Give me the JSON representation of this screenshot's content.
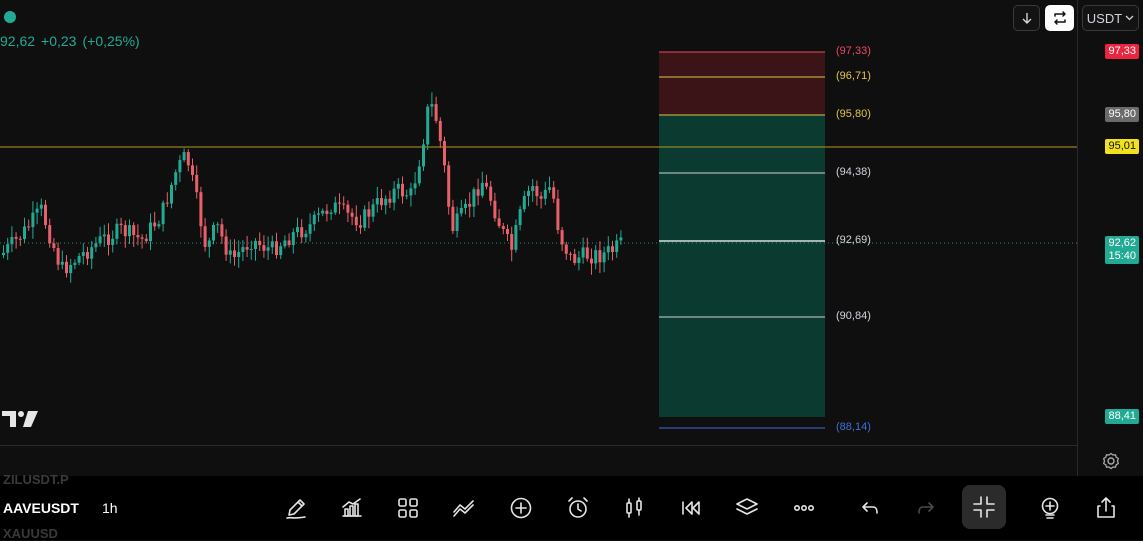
{
  "symbol_quote": {
    "price": "92,62",
    "change": "+0,23",
    "change_pct": "(+0,25%)"
  },
  "currency_selector": "USDT",
  "price_scale": {
    "stop_price": "97,33",
    "grey_price": "95,80",
    "horizontal_line_price": "95,01",
    "current_price": "92,62",
    "countdown": "15:40",
    "target_price": "88,41"
  },
  "position_levels": [
    {
      "label": "(97,33)",
      "color": "#e84a5f"
    },
    {
      "label": "(96,71)",
      "color": "#e0c34a"
    },
    {
      "label": "(95,80)",
      "color": "#e0c34a"
    },
    {
      "label": "(94,38)",
      "color": "#d1d4dc"
    },
    {
      "label": "(92,69)",
      "color": "#d1d4dc"
    },
    {
      "label": "(90,84)",
      "color": "#d1d4dc"
    },
    {
      "label": "(88,14)",
      "color": "#3f6fd8"
    }
  ],
  "watchlist": {
    "prev_symbol": "ZILUSDT.P",
    "current_symbol": "AAVEUSDT",
    "next_symbol": "XAUUSD",
    "timeframe": "1h"
  },
  "colors": {
    "up": "#22ab94",
    "down": "#e8606a",
    "stop_zone": "#3a1417",
    "target_zone": "#0b3a30",
    "accent": "#22ab94"
  },
  "toolbar_icons": [
    "pencil-icon",
    "indicators-icon",
    "grid-icon",
    "drawing-line-icon",
    "plus-circle-icon",
    "alarm-icon",
    "candlestick-icon",
    "replay-icon",
    "layers-icon",
    "more-icon",
    "undo-icon",
    "redo-icon",
    "collapse-icon",
    "add-symbol-icon",
    "share-icon"
  ]
}
